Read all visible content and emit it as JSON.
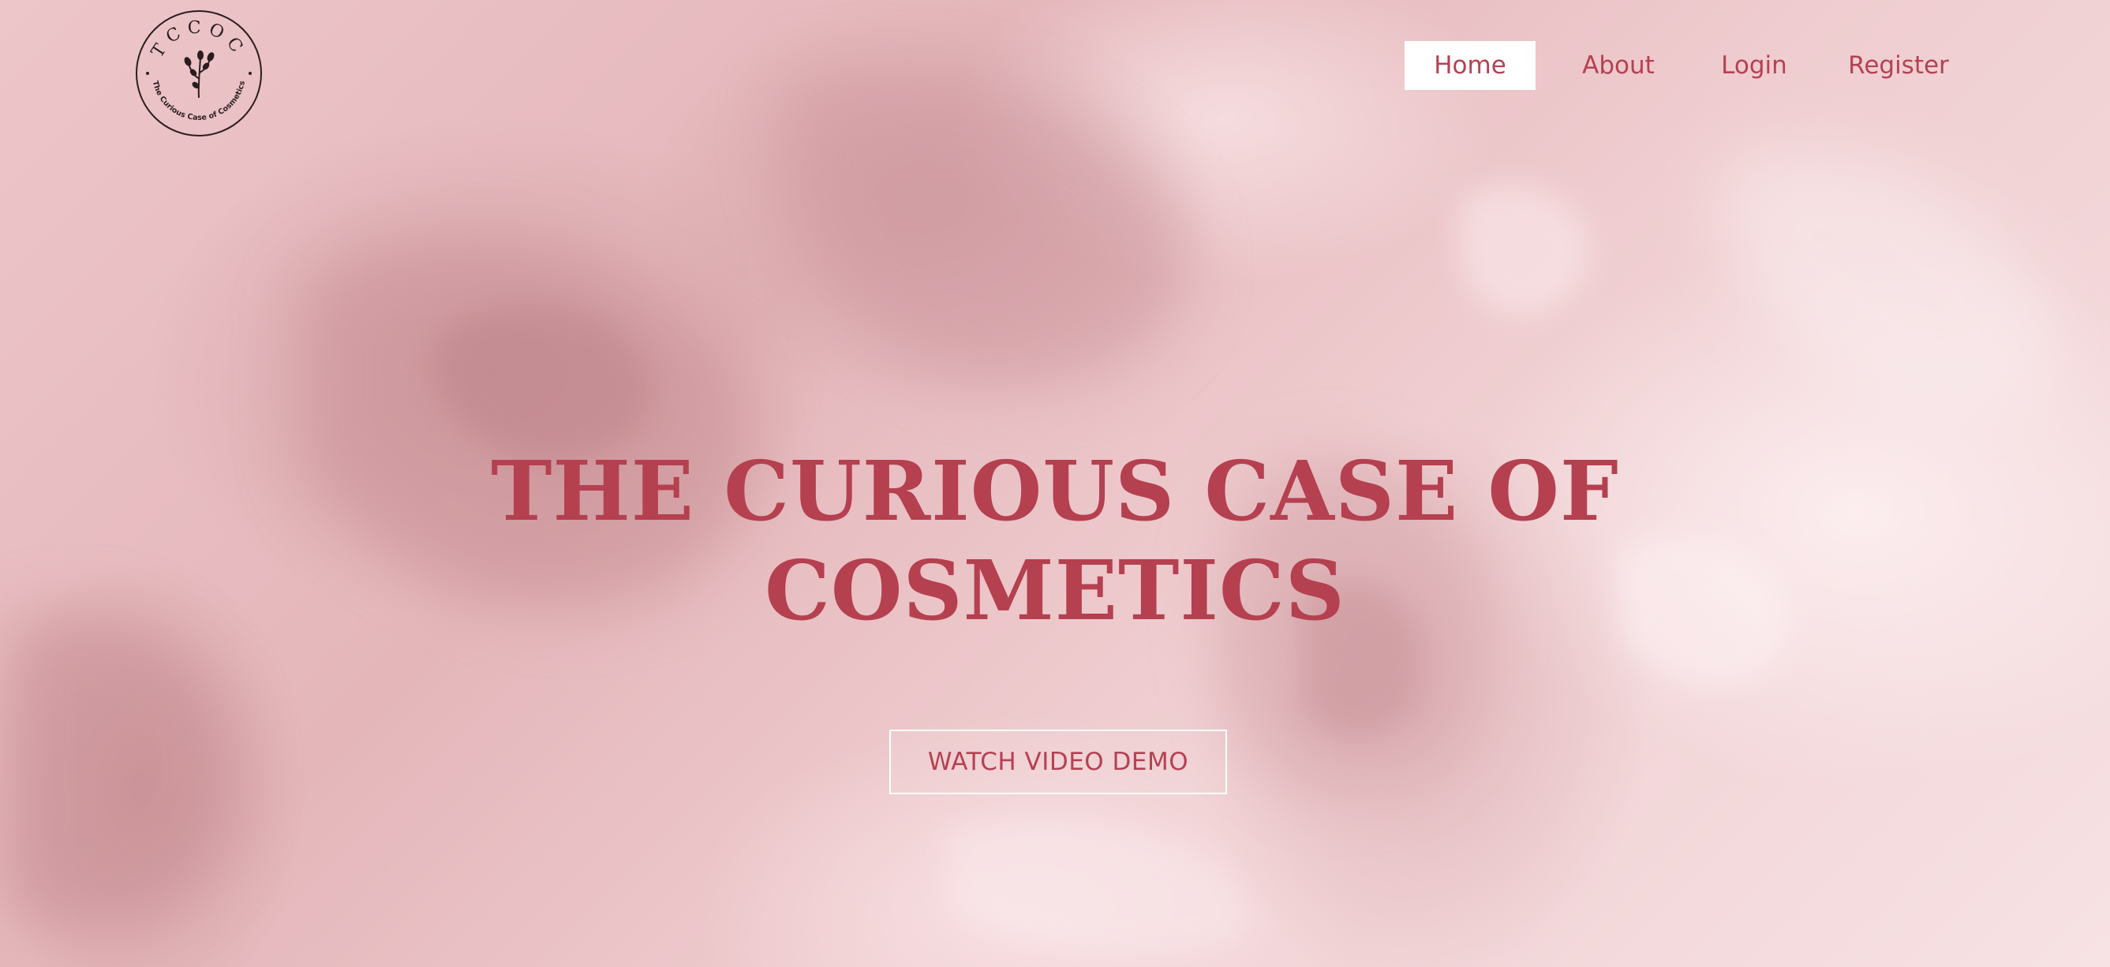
{
  "logo": {
    "monogram": "TCCOC",
    "ring_text": "The Curious Case of Cosmetics",
    "icon": "flower-sprig-icon"
  },
  "nav": {
    "items": [
      {
        "label": "Home",
        "active": true
      },
      {
        "label": "About",
        "active": false
      },
      {
        "label": "Login",
        "active": false
      },
      {
        "label": "Register",
        "active": false
      }
    ]
  },
  "hero": {
    "title_line1": "THE CURIOUS CASE OF",
    "title_line2": "COSMETICS",
    "cta_label": "WATCH VIDEO DEMO"
  },
  "colors": {
    "accent": "#b5404f",
    "nav_active_bg": "#ffffff",
    "background": "#ecc4c8"
  }
}
